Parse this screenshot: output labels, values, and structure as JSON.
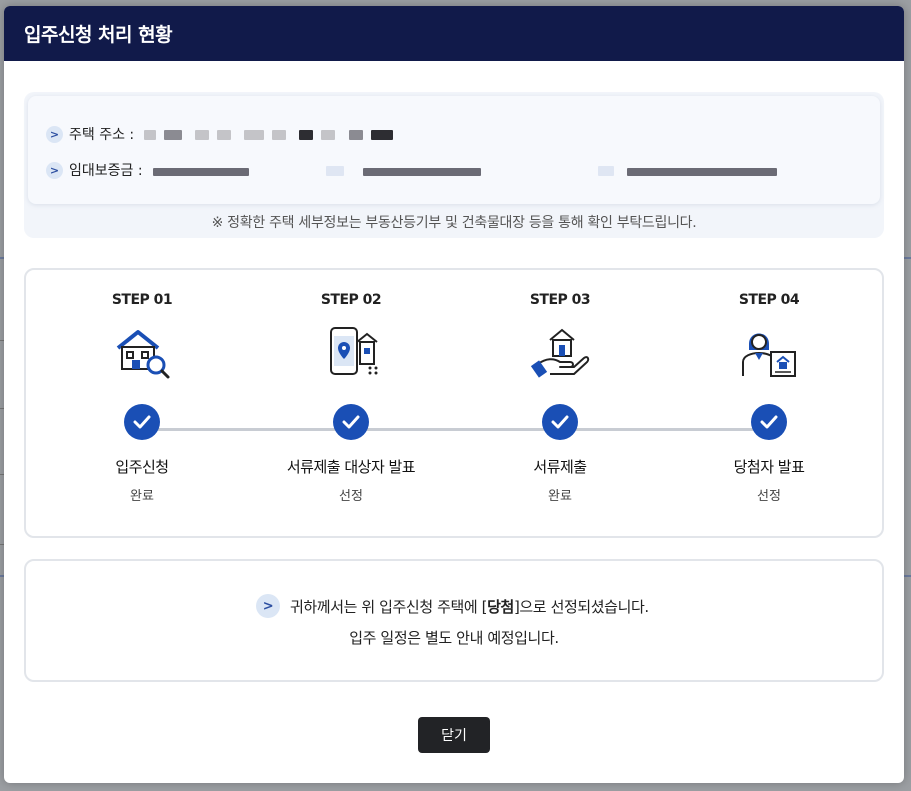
{
  "modal": {
    "title": "입주신청 처리 현황",
    "close_label": "닫기"
  },
  "info": {
    "address_label": "주택 주소 :",
    "deposit_label": "임대보증금 :",
    "note": "※ 정확한 주택 세부정보는 부동산등기부 및 건축물대장 등을 통해 확인 부탁드립니다."
  },
  "steps": [
    {
      "label": "STEP 01",
      "title": "입주신청",
      "status": "완료",
      "icon": "house-search-icon"
    },
    {
      "label": "STEP 02",
      "title": "서류제출 대상자 발표",
      "status": "선정",
      "icon": "phone-map-icon"
    },
    {
      "label": "STEP 03",
      "title": "서류제출",
      "status": "완료",
      "icon": "hand-house-icon"
    },
    {
      "label": "STEP 04",
      "title": "당첨자 발표",
      "status": "선정",
      "icon": "person-board-icon"
    }
  ],
  "result": {
    "line1_prefix": "귀하께서는 위 입주신청 주택에 [",
    "line1_highlight": "당첨",
    "line1_suffix": "]으로 선정되셨습니다.",
    "line2": "입주 일정은 별도 안내 예정입니다."
  },
  "colors": {
    "header_bg": "#111a4a",
    "accent": "#1a4fb5",
    "close_button": "#222326"
  }
}
